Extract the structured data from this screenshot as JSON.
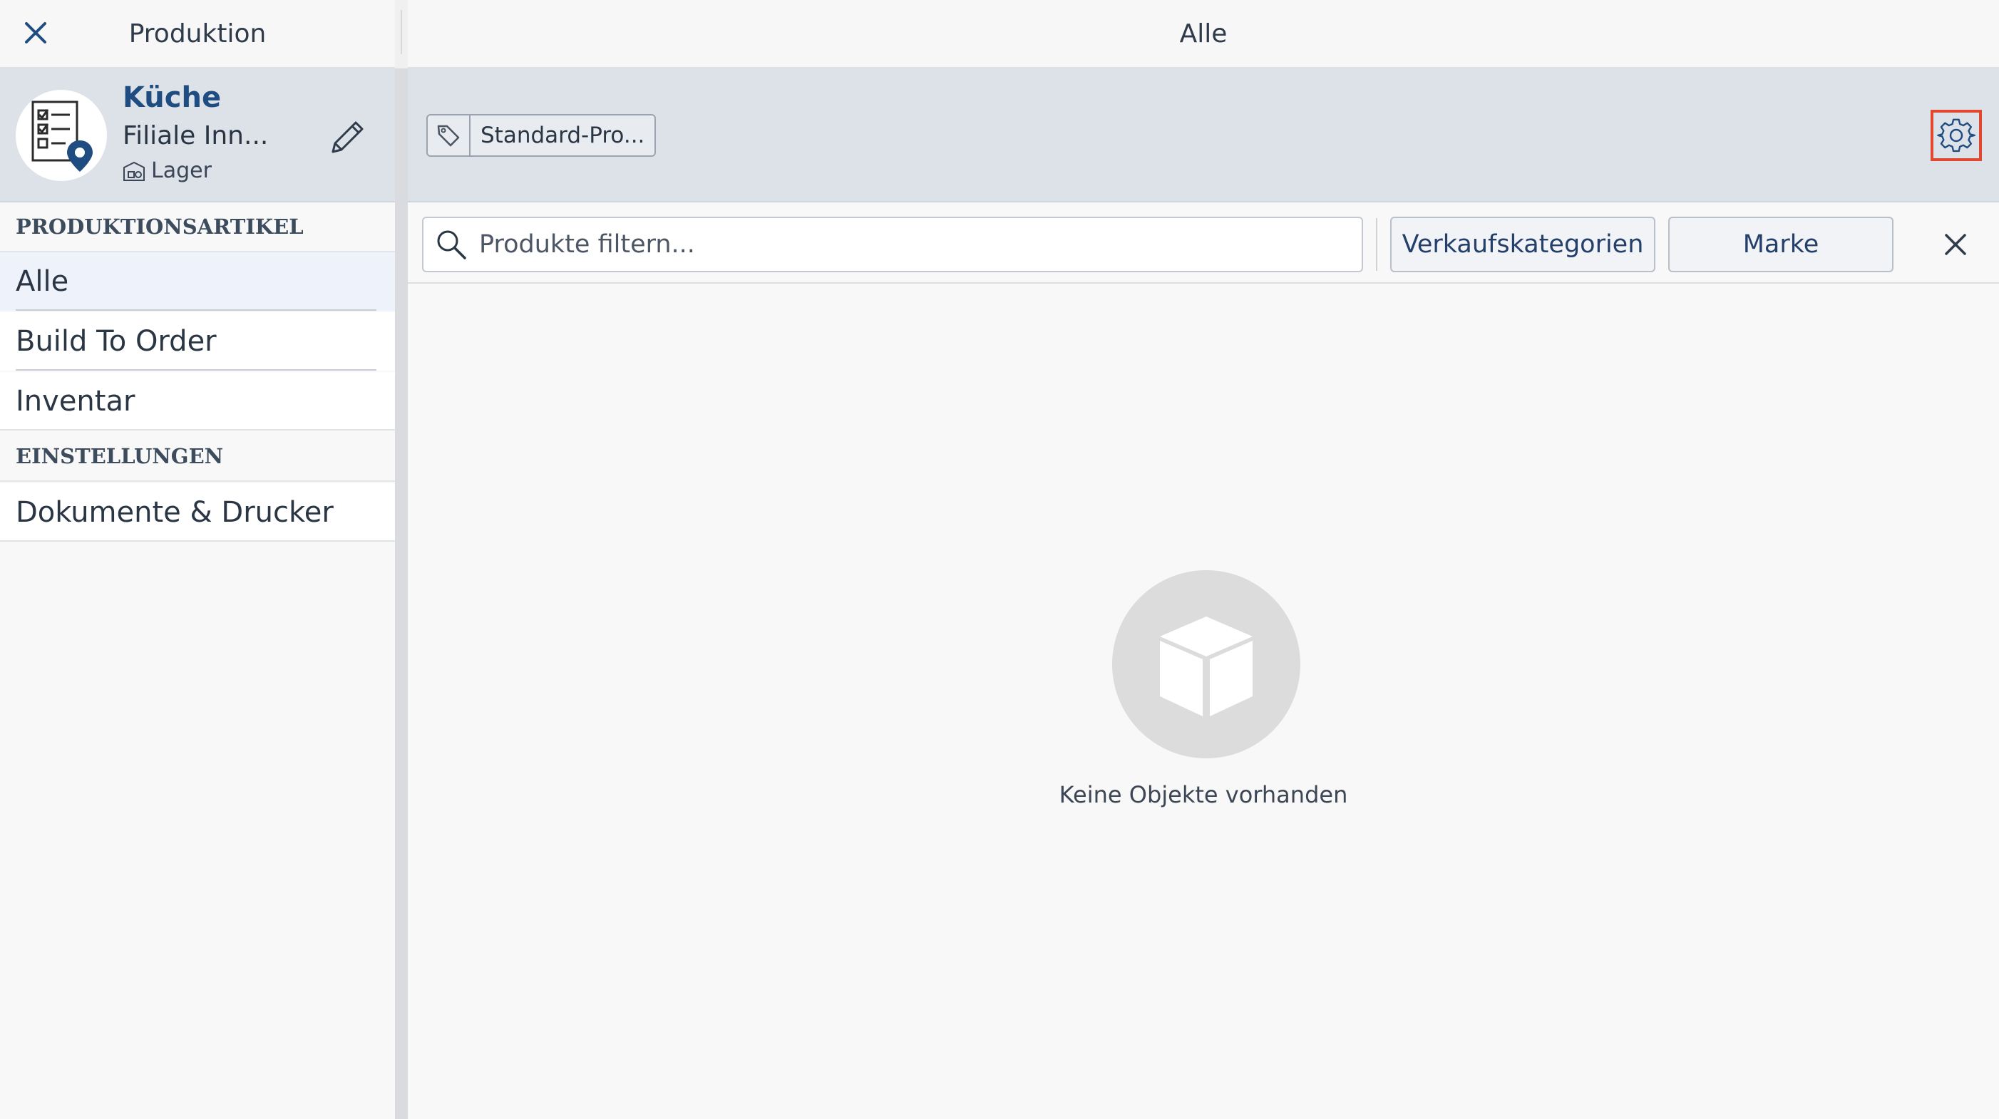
{
  "sidebar": {
    "title": "Produktion",
    "location": {
      "name": "Küche",
      "branch": "Filiale Inn...",
      "type": "Lager"
    },
    "sections": [
      {
        "header": "PRODUKTIONSARTIKEL",
        "items": [
          {
            "label": "Alle",
            "active": true
          },
          {
            "label": "Build To Order",
            "active": false
          },
          {
            "label": "Inventar",
            "active": false
          }
        ]
      },
      {
        "header": "EINSTELLUNGEN",
        "items": [
          {
            "label": "Dokumente & Drucker",
            "active": false
          }
        ]
      }
    ]
  },
  "main": {
    "title": "Alle",
    "tag_chip_label": "Standard-Pro...",
    "search_placeholder": "Produkte filtern...",
    "filters": {
      "category_label": "Verkaufskategorien",
      "brand_label": "Marke"
    },
    "empty_state": {
      "message": "Keine Objekte vorhanden"
    }
  },
  "colors": {
    "accent": "#1f4d82",
    "highlight_border": "#e2472f",
    "toolbar_bg": "#dde2e9",
    "active_item_bg": "#eef3fb"
  },
  "icons": {
    "close": "close-icon",
    "edit": "pencil-icon",
    "tag": "tag-icon",
    "settings": "gear-icon",
    "search": "search-icon",
    "empty": "box-icon",
    "location": "checklist-location-icon",
    "warehouse": "warehouse-icon"
  }
}
